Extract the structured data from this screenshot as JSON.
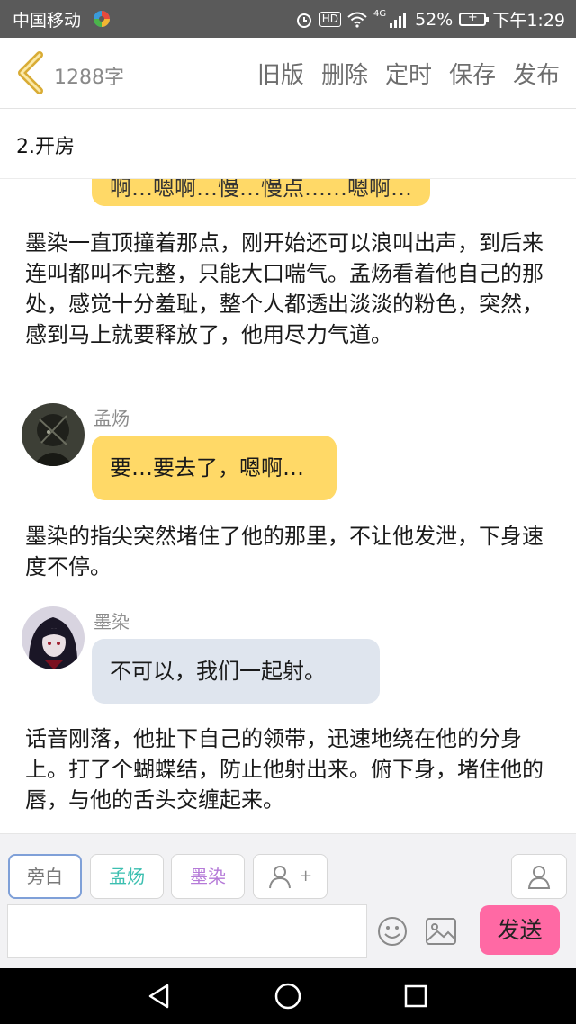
{
  "status_bar": {
    "carrier": "中国移动",
    "network": "4G",
    "battery": "52%",
    "time": "下午1:29"
  },
  "header": {
    "word_count": "1288字",
    "actions": [
      "旧版",
      "删除",
      "定时",
      "保存",
      "发布"
    ]
  },
  "chapter": {
    "title": "2.开房"
  },
  "content": {
    "partial_bubble": "啊…嗯啊…慢…慢点……嗯啊…",
    "narration_1": "墨染一直顶撞着那点，刚开始还可以浪叫出声，到后来连叫都叫不完整，只能大口喘气。孟炀看着他自己的那处，感觉十分羞耻，整个人都透出淡淡的粉色，突然，感到马上就要释放了，他用尽力气道。",
    "msg_1": {
      "speaker": "孟炀",
      "text": "要…要去了，嗯啊…"
    },
    "narration_2": "墨染的指尖突然堵住了他的那里，不让他发泄，下身速度不停。",
    "msg_2": {
      "speaker": "墨染",
      "text": "不可以，我们一起射。"
    },
    "narration_3": "话音刚落，他扯下自己的领带，迅速地绕在他的分身上。打了个蝴蝶结，防止他射出来。俯下身，堵住他的唇，与他的舌头交缠起来。"
  },
  "composer": {
    "roles": [
      "旁白",
      "孟炀",
      "墨染"
    ],
    "add_role": "+",
    "input_value": "",
    "send": "发送"
  },
  "colors": {
    "yellow_bubble": "#ffd967",
    "gray_bubble": "#dfe5ee",
    "send_button": "#ff69a4",
    "role_mengyang": "#3bbfb0",
    "role_moran": "#b57ad8"
  }
}
